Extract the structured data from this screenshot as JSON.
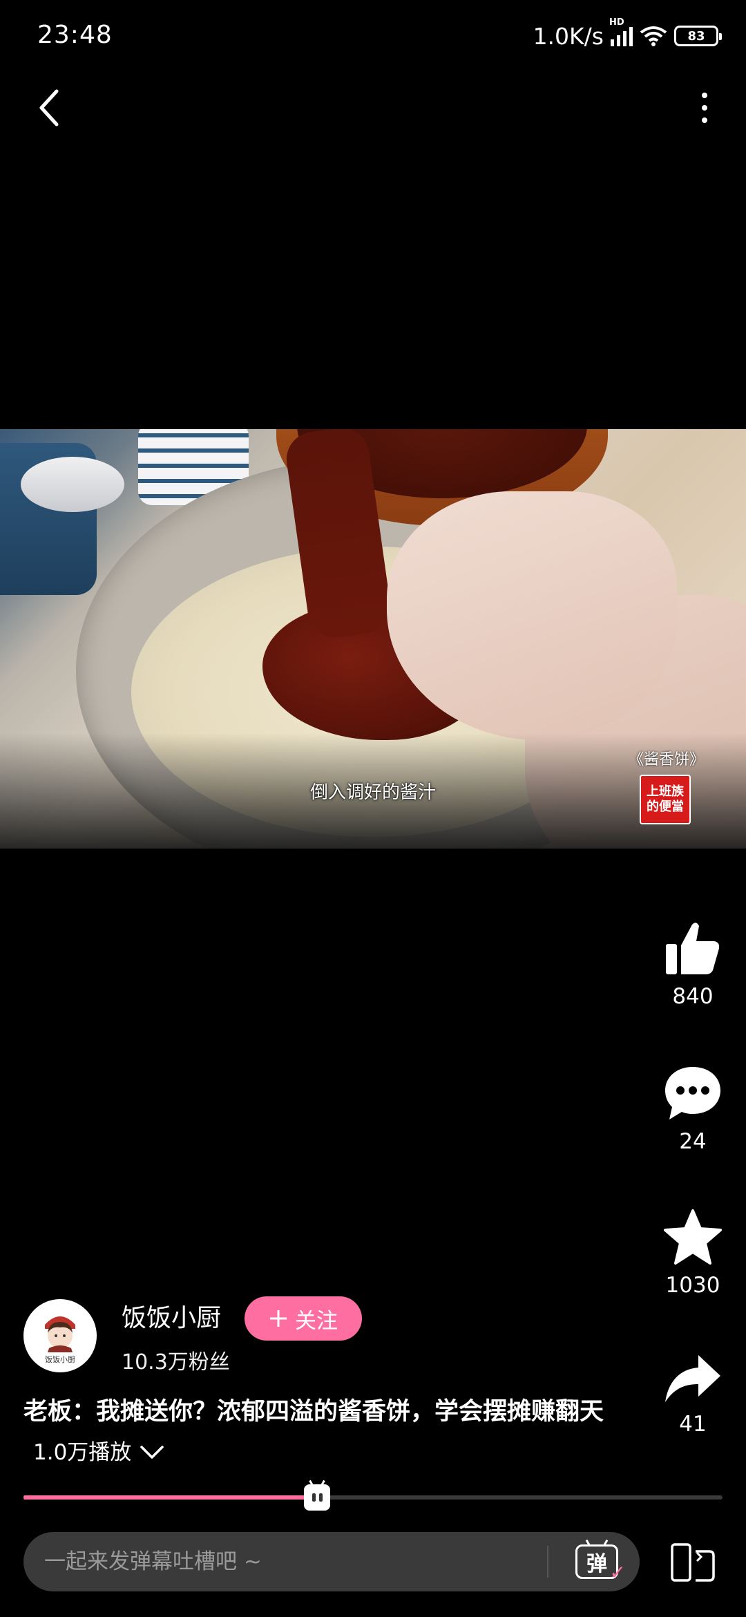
{
  "status_bar": {
    "time": "23:48",
    "net_speed": "1.0K/s",
    "network_badge": "HD",
    "battery": "83"
  },
  "video": {
    "subtitle": "倒入调好的酱汁",
    "watermark_title": "《酱香饼》",
    "watermark_logo_line1": "上班族",
    "watermark_logo_line2": "的便當"
  },
  "actions": {
    "likes": "840",
    "comments": "24",
    "favorites": "1030",
    "shares": "41"
  },
  "author": {
    "name": "饭饭小厨",
    "avatar_text": "饭饭小厨",
    "fans": "10.3万粉丝",
    "follow_label": "关注"
  },
  "title": {
    "text": "老板：我摊送你？浓郁四溢的酱香饼，学会摆摊赚翻天",
    "plays": "1.0万播放"
  },
  "progress": {
    "fraction": 0.42
  },
  "danmu": {
    "placeholder": "一起来发弹幕吐槽吧 ~",
    "toggle_label": "弹"
  },
  "colors": {
    "accent": "#ff6ea0",
    "background": "#000000",
    "input_bg": "#3a3a3a"
  },
  "icons": [
    "chevron-left-icon",
    "more-vertical-icon",
    "thumbs-up-icon",
    "comment-icon",
    "star-icon",
    "share-icon",
    "chevron-down-icon",
    "rotate-screen-icon"
  ]
}
